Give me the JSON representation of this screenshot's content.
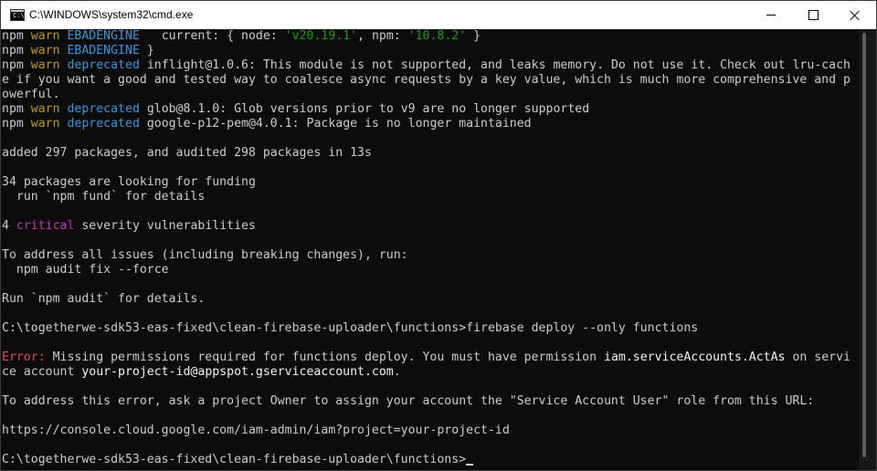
{
  "window": {
    "title": "C:\\WINDOWS\\system32\\cmd.exe",
    "icon": "cmd-icon",
    "icon_text": "C:\\",
    "controls": {
      "minimize": "minimize-icon",
      "maximize": "maximize-icon",
      "close": "close-icon"
    }
  },
  "colors": {
    "warn": "#c19c00",
    "keyword": "#3a96dd",
    "string": "#13a10e",
    "critical": "#c837b7",
    "error": "#e74856",
    "text": "#cccccc",
    "bright": "#f2f2f2"
  },
  "console": {
    "lines": [
      [
        {
          "t": "npm "
        },
        {
          "t": "warn",
          "c": "warn"
        },
        {
          "t": " "
        },
        {
          "t": "EBADENGINE",
          "c": "blue"
        },
        {
          "t": "   current: { node: "
        },
        {
          "t": "'v20.19.1'",
          "c": "green"
        },
        {
          "t": ", npm: "
        },
        {
          "t": "'10.8.2'",
          "c": "green"
        },
        {
          "t": " }"
        }
      ],
      [
        {
          "t": "npm "
        },
        {
          "t": "warn",
          "c": "warn"
        },
        {
          "t": " "
        },
        {
          "t": "EBADENGINE",
          "c": "blue"
        },
        {
          "t": " }"
        }
      ],
      [
        {
          "t": "npm "
        },
        {
          "t": "warn",
          "c": "warn"
        },
        {
          "t": " "
        },
        {
          "t": "deprecated",
          "c": "blue"
        },
        {
          "t": " inflight@1.0.6: This module is not supported, and leaks memory. Do not use it. Check out lru-cach"
        }
      ],
      [
        {
          "t": "e if you want a good and tested way to coalesce async requests by a key value, which is much more comprehensive and p"
        }
      ],
      [
        {
          "t": "owerful."
        }
      ],
      [
        {
          "t": "npm "
        },
        {
          "t": "warn",
          "c": "warn"
        },
        {
          "t": " "
        },
        {
          "t": "deprecated",
          "c": "blue"
        },
        {
          "t": " glob@8.1.0: Glob versions prior to v9 are no longer supported"
        }
      ],
      [
        {
          "t": "npm "
        },
        {
          "t": "warn",
          "c": "warn"
        },
        {
          "t": " "
        },
        {
          "t": "deprecated",
          "c": "blue"
        },
        {
          "t": " google-p12-pem@4.0.1: Package is no longer maintained"
        }
      ],
      [],
      [
        {
          "t": "added 297 packages, and audited 298 packages in 13s"
        }
      ],
      [],
      [
        {
          "t": "34 packages are looking for funding"
        }
      ],
      [
        {
          "t": "  run `npm fund` for details"
        }
      ],
      [],
      [
        {
          "t": "4 "
        },
        {
          "t": "critical",
          "c": "mag"
        },
        {
          "t": " severity vulnerabilities"
        }
      ],
      [],
      [
        {
          "t": "To address all issues (including breaking changes), run:"
        }
      ],
      [
        {
          "t": "  npm audit fix --force"
        }
      ],
      [],
      [
        {
          "t": "Run `npm audit` for details."
        }
      ],
      [],
      [
        {
          "t": "C:\\togetherwe-sdk53-eas-fixed\\clean-firebase-uploader\\functions>firebase deploy --only functions"
        }
      ],
      [],
      [
        {
          "t": "Error:",
          "c": "red"
        },
        {
          "t": " Missing permissions required for functions deploy. You must have permission "
        },
        {
          "t": "iam.serviceAccounts.ActAs",
          "c": "white"
        },
        {
          "t": " on servi"
        }
      ],
      [
        {
          "t": "ce account "
        },
        {
          "t": "your-project-id@appspot.gserviceaccount.com",
          "c": "white"
        },
        {
          "t": "."
        }
      ],
      [],
      [
        {
          "t": "To address this error, ask a project Owner to assign your account the \"Service Account User\" role from this URL:"
        }
      ],
      [],
      [
        {
          "t": "https://console.cloud.google.com/iam-admin/iam?project=your-project-id"
        }
      ],
      [],
      [
        {
          "t": "C:\\togetherwe-sdk53-eas-fixed\\clean-firebase-uploader\\functions>"
        },
        {
          "cursor": true
        }
      ]
    ]
  }
}
